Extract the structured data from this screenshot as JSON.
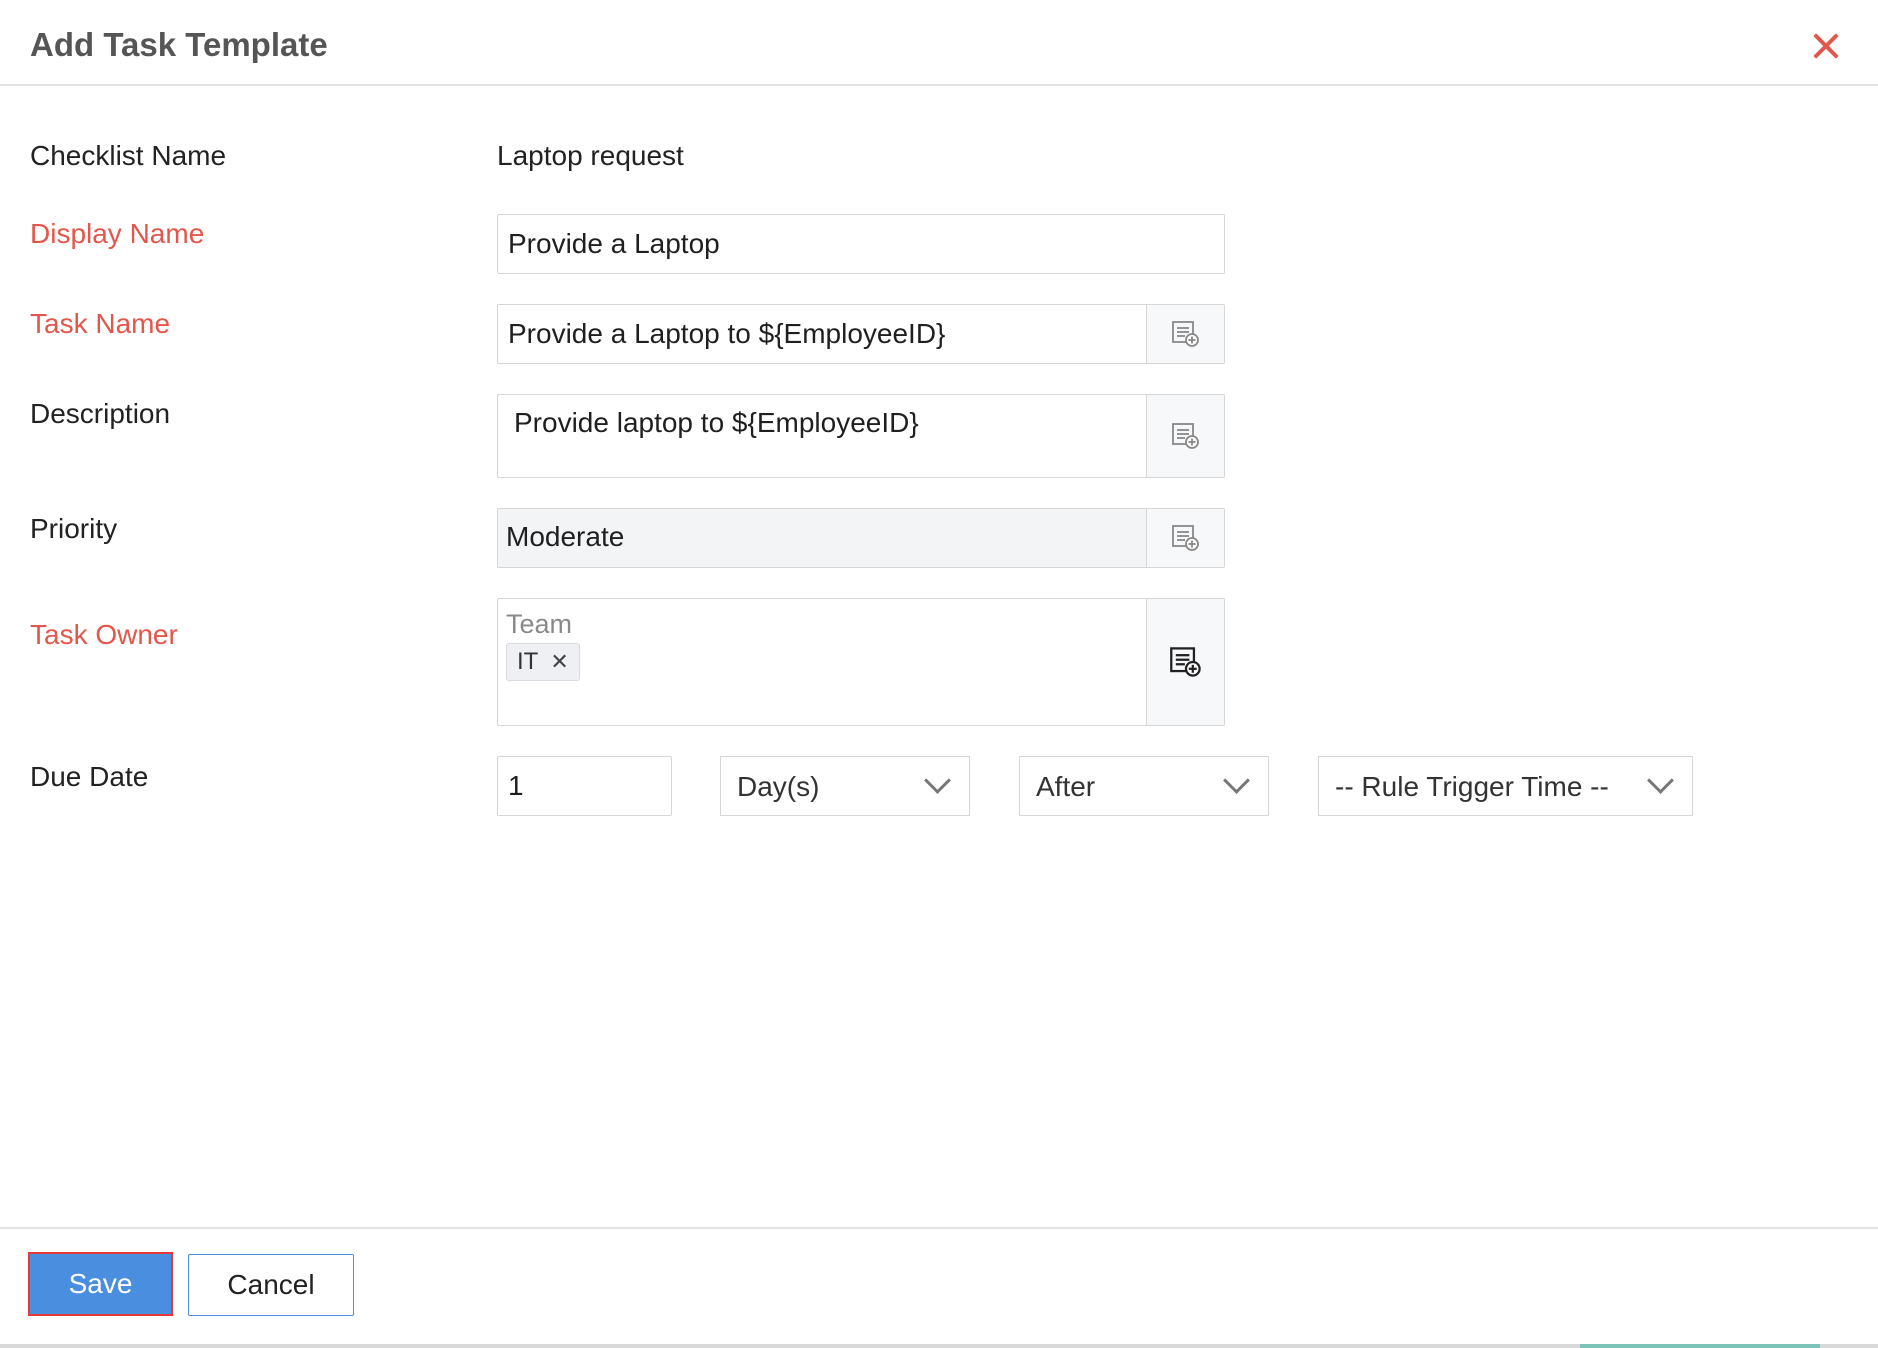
{
  "dialog": {
    "title": "Add Task Template"
  },
  "form": {
    "checklist_name": {
      "label": "Checklist Name",
      "value": "Laptop request"
    },
    "display_name": {
      "label": "Display Name",
      "value": "Provide a Laptop"
    },
    "task_name": {
      "label": "Task Name",
      "value": "Provide a Laptop to ${EmployeeID}"
    },
    "description": {
      "label": "Description",
      "value": "Provide laptop to ${EmployeeID}"
    },
    "priority": {
      "label": "Priority",
      "value": "Moderate"
    },
    "task_owner": {
      "label": "Task Owner",
      "placeholder": "Team",
      "tags": [
        "IT"
      ]
    },
    "due_date": {
      "label": "Due Date",
      "amount": "1",
      "unit": "Day(s)",
      "relation": "After",
      "reference": "-- Rule Trigger Time --"
    }
  },
  "footer": {
    "save_label": "Save",
    "cancel_label": "Cancel"
  },
  "colors": {
    "required_label": "#e2574c",
    "primary": "#4a8ee0",
    "focus_outline": "#e03a3a"
  }
}
